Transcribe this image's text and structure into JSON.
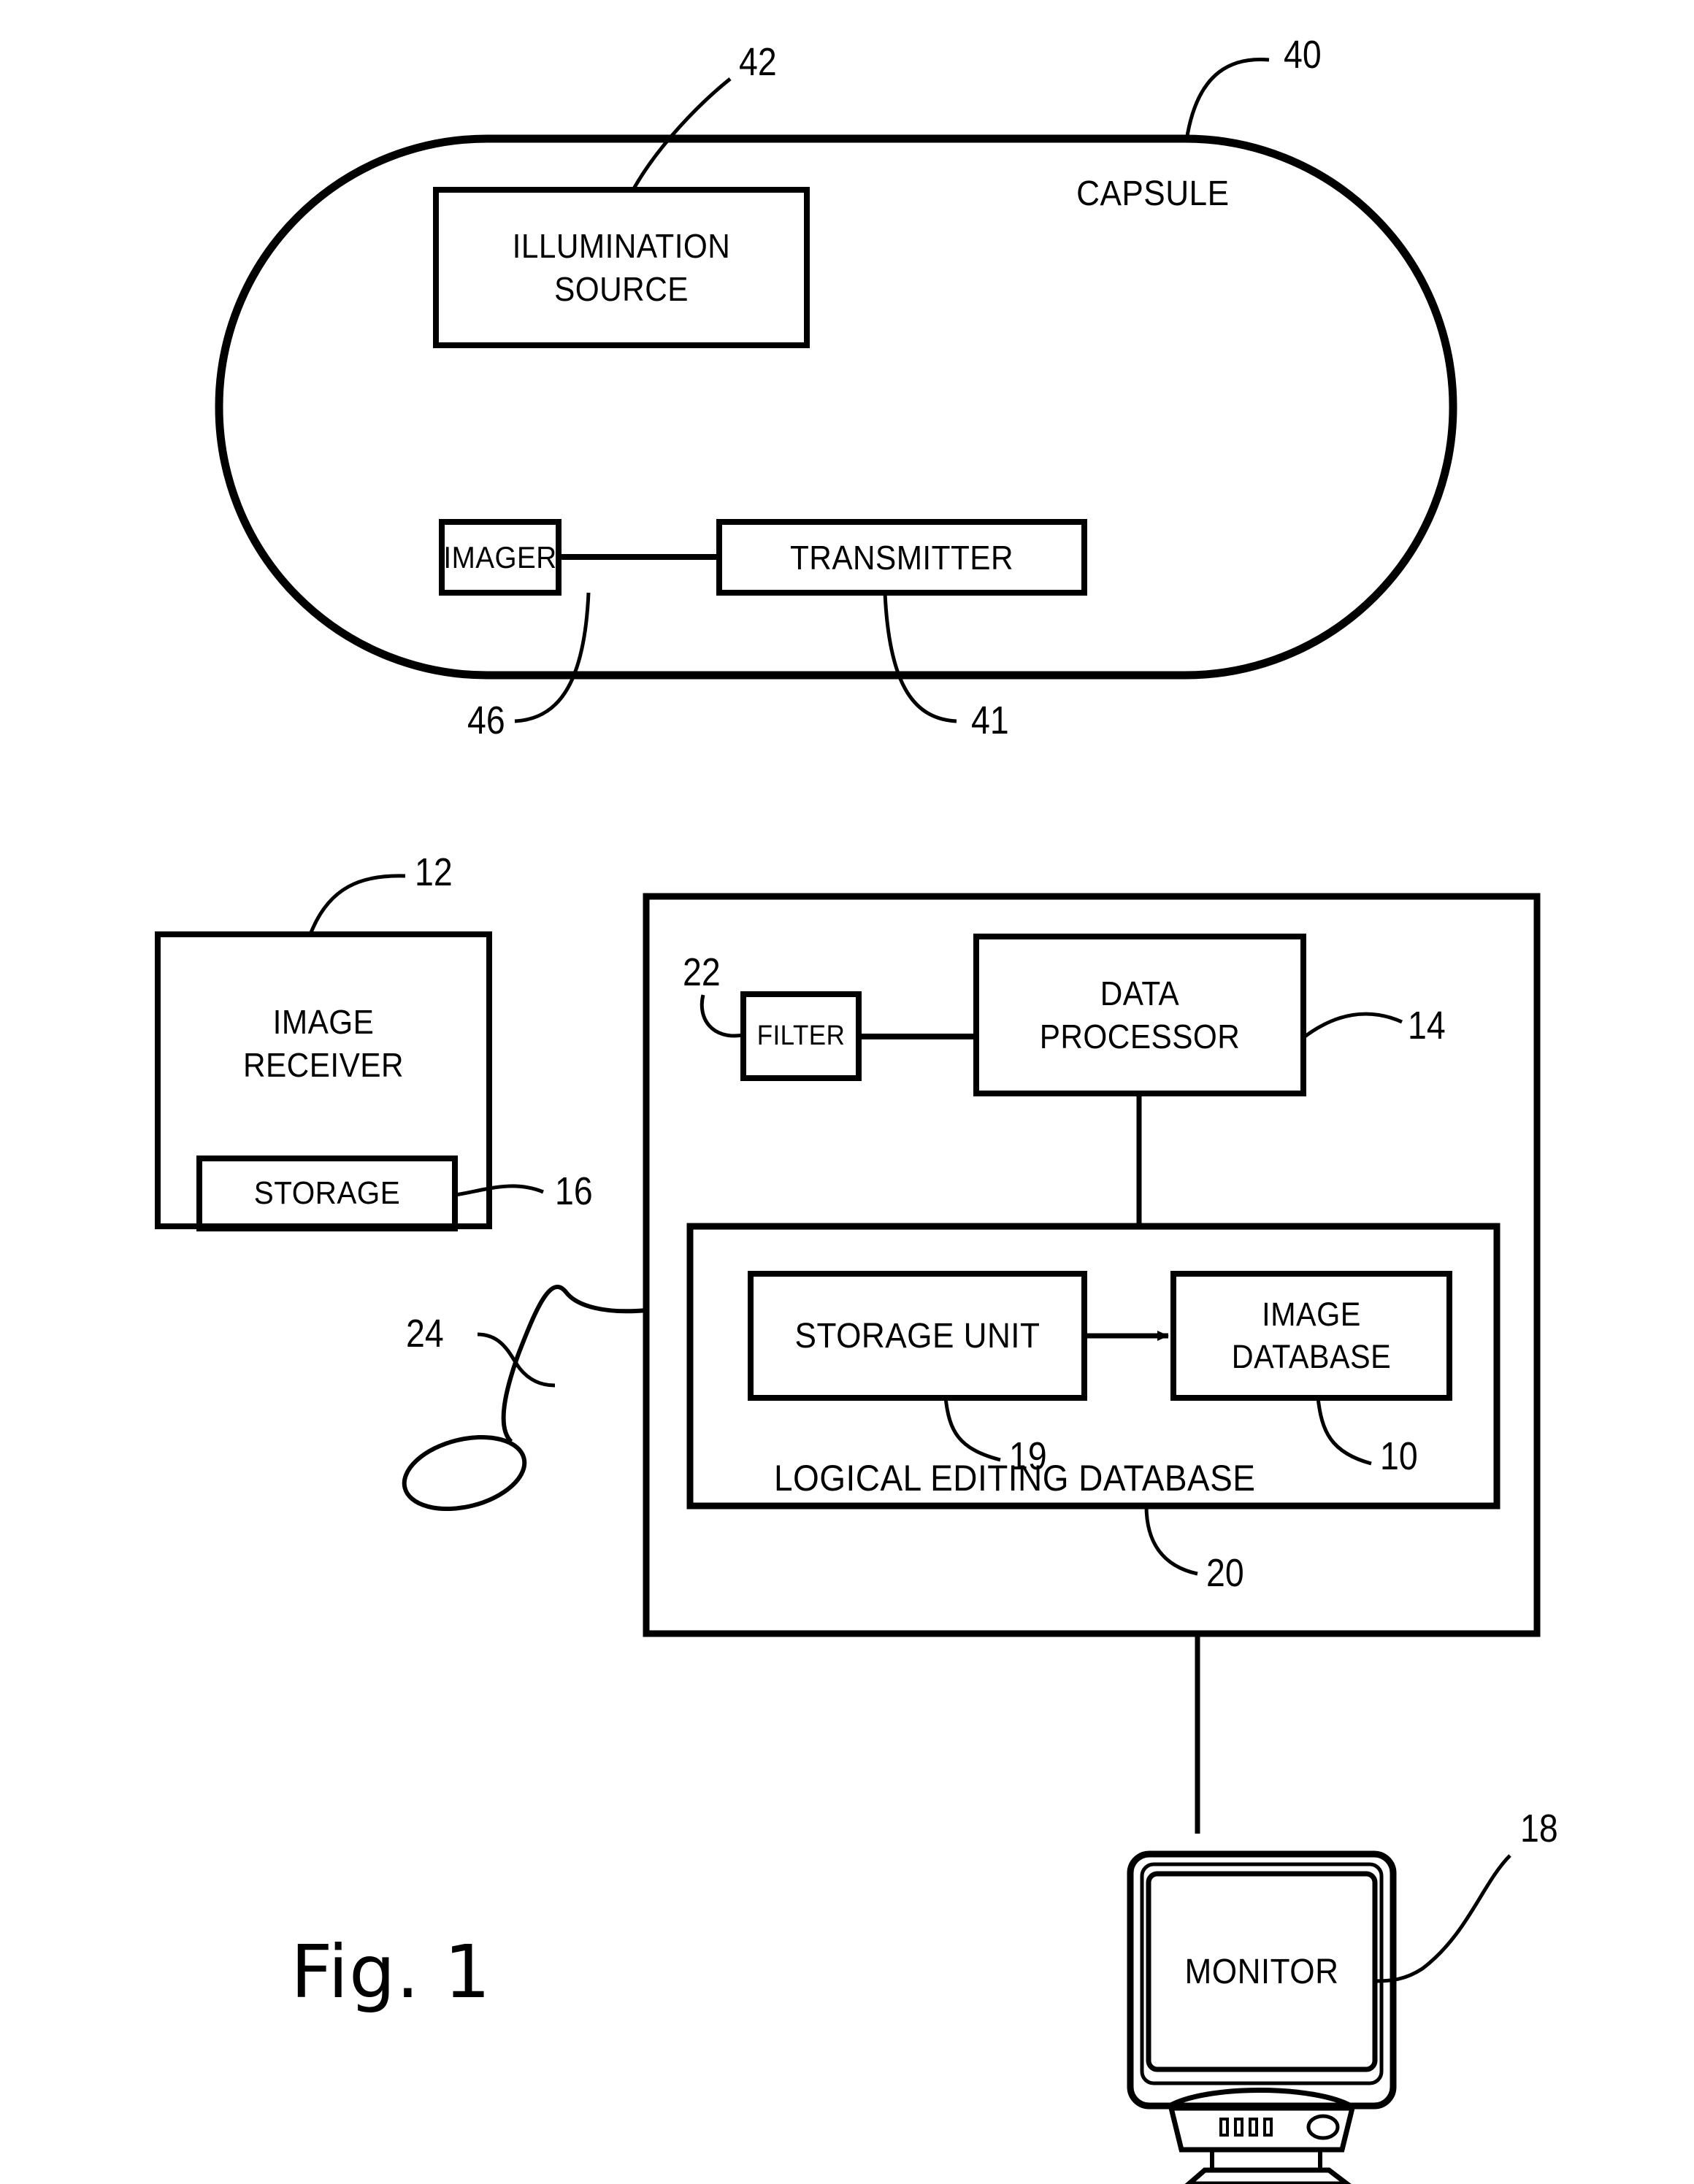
{
  "figure": {
    "caption": "Fig. 1",
    "type": "patent-block-diagram"
  },
  "capsule": {
    "label": "CAPSULE",
    "ref": "40",
    "blocks": [
      {
        "id": "illumination-source",
        "label": "ILLUMINATION SOURCE",
        "line1": "ILLUMINATION",
        "line2": "SOURCE",
        "ref": "42"
      },
      {
        "id": "imager",
        "label": "IMAGER",
        "ref": "46"
      },
      {
        "id": "transmitter",
        "label": "TRANSMITTER",
        "ref": "41"
      }
    ]
  },
  "image_receiver": {
    "label": "IMAGE RECEIVER",
    "line1": "IMAGE",
    "line2": "RECEIVER",
    "ref": "12",
    "storage": {
      "label": "STORAGE",
      "ref": "16"
    }
  },
  "antenna": {
    "label": "",
    "ref": "24"
  },
  "workstation": {
    "ref": "20",
    "blocks": [
      {
        "id": "filter",
        "label": "FILTER",
        "ref": "22"
      },
      {
        "id": "data-processor",
        "label": "DATA PROCESSOR",
        "line1": "DATA",
        "line2": "PROCESSOR",
        "ref": "14"
      }
    ],
    "logical_editing_database": {
      "label": "LOGICAL EDITING DATABASE",
      "blocks": [
        {
          "id": "storage-unit",
          "label": "STORAGE UNIT",
          "ref": "19"
        },
        {
          "id": "image-database",
          "label": "IMAGE DATABASE",
          "line1": "IMAGE",
          "line2": "DATABASE",
          "ref": "10"
        }
      ]
    }
  },
  "monitor": {
    "label": "MONITOR",
    "ref": "18"
  },
  "colors": {
    "ink": "#000000",
    "paper": "#ffffff"
  }
}
